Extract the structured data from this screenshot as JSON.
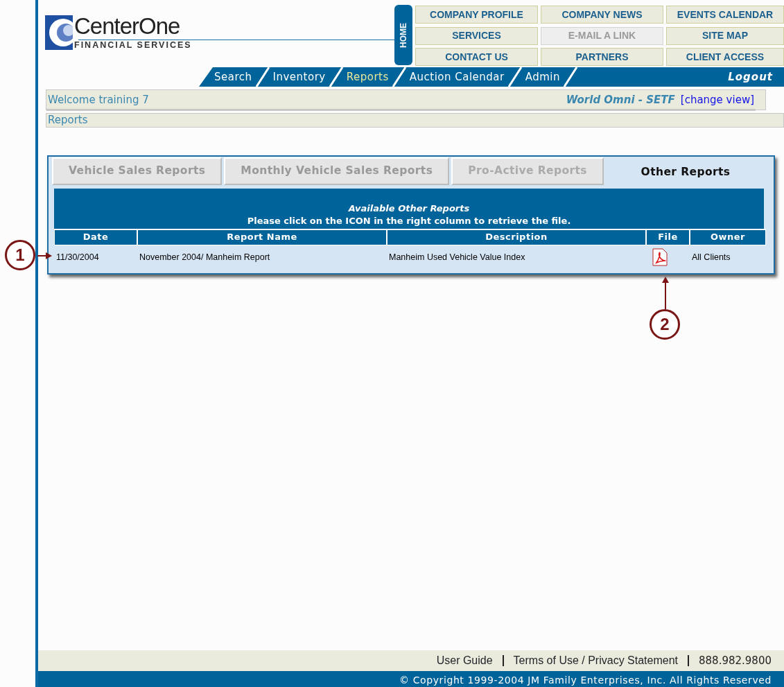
{
  "logo": {
    "name": "CenterOne",
    "tagline": "FINANCIAL SERVICES"
  },
  "home_label": "HOME",
  "top_links": [
    {
      "label": "COMPANY PROFILE",
      "disabled": false
    },
    {
      "label": "COMPANY NEWS",
      "disabled": false
    },
    {
      "label": "EVENTS CALENDAR",
      "disabled": false
    },
    {
      "label": "SERVICES",
      "disabled": false
    },
    {
      "label": "E-MAIL A LINK",
      "disabled": true
    },
    {
      "label": "SITE MAP",
      "disabled": false
    },
    {
      "label": "CONTACT US",
      "disabled": false
    },
    {
      "label": "PARTNERS",
      "disabled": false
    },
    {
      "label": "CLIENT ACCESS",
      "disabled": false
    }
  ],
  "nav_tabs": [
    {
      "label": "Search",
      "selected": false
    },
    {
      "label": "Inventory",
      "selected": false
    },
    {
      "label": "Reports",
      "selected": true
    },
    {
      "label": "Auction Calendar",
      "selected": false
    },
    {
      "label": "Admin",
      "selected": false
    }
  ],
  "logout": "Logout",
  "welcome": "Welcome training 7",
  "account": "World Omni - SETF",
  "change_view": "[change view]",
  "breadcrumb": "Reports",
  "report_tabs": [
    {
      "label": "Vehicle Sales Reports",
      "selected": false,
      "disabled": false
    },
    {
      "label": "Monthly Vehicle Sales Reports",
      "selected": false,
      "disabled": false
    },
    {
      "label": "Pro-Active Reports",
      "selected": false,
      "disabled": true
    },
    {
      "label": "Other Reports",
      "selected": true,
      "disabled": false
    }
  ],
  "table": {
    "title": "Available Other Reports",
    "instruction": "Please click on the ICON in the right column to retrieve the file.",
    "columns": [
      "Date",
      "Report Name",
      "Description",
      "File",
      "Owner"
    ],
    "rows": [
      {
        "date": "11/30/2004",
        "report_name": "November 2004/ Manheim Report",
        "description": "Manheim Used Vehicle Value Index",
        "owner": "All Clients"
      }
    ]
  },
  "callouts": [
    {
      "number": "1"
    },
    {
      "number": "2"
    }
  ],
  "footer": {
    "links": [
      "User Guide",
      "Terms of Use / Privacy Statement"
    ],
    "phone": "888.982.9800",
    "copyright": "© Copyright 1999-2004 JM Family Enterprises, Inc. All Rights Reserved"
  }
}
